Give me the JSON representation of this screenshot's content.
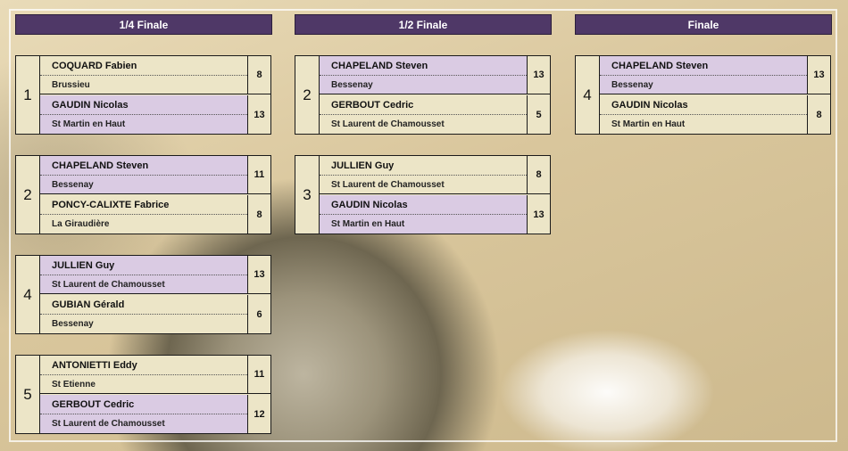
{
  "rounds": [
    {
      "label": "1/4 Finale"
    },
    {
      "label": "1/2 Finale"
    },
    {
      "label": "Finale"
    }
  ],
  "colors": {
    "header_bg": "#4f3867",
    "winner_bg": "#dacbe3",
    "loser_bg": "#ece5c7"
  },
  "matches": [
    {
      "round": "1/4 Finale",
      "num": "1",
      "p1": {
        "name": "COQUARD Fabien",
        "club": "Brussieu",
        "score": "8",
        "winner": false
      },
      "p2": {
        "name": "GAUDIN Nicolas",
        "club": "St Martin en Haut",
        "score": "13",
        "winner": true
      }
    },
    {
      "round": "1/4 Finale",
      "num": "2",
      "p1": {
        "name": "CHAPELAND Steven",
        "club": "Bessenay",
        "score": "11",
        "winner": true
      },
      "p2": {
        "name": "PONCY-CALIXTE Fabrice",
        "club": "La Giraudière",
        "score": "8",
        "winner": false
      }
    },
    {
      "round": "1/4 Finale",
      "num": "4",
      "p1": {
        "name": "JULLIEN Guy",
        "club": "St Laurent de Chamousset",
        "score": "13",
        "winner": true
      },
      "p2": {
        "name": "GUBIAN Gérald",
        "club": "Bessenay",
        "score": "6",
        "winner": false
      }
    },
    {
      "round": "1/4 Finale",
      "num": "5",
      "p1": {
        "name": "ANTONIETTI Eddy",
        "club": "St Etienne",
        "score": "11",
        "winner": false
      },
      "p2": {
        "name": "GERBOUT Cedric",
        "club": "St Laurent de Chamousset",
        "score": "12",
        "winner": true
      }
    },
    {
      "round": "1/2 Finale",
      "num": "2",
      "p1": {
        "name": "CHAPELAND Steven",
        "club": "Bessenay",
        "score": "13",
        "winner": true
      },
      "p2": {
        "name": "GERBOUT Cedric",
        "club": "St Laurent de Chamousset",
        "score": "5",
        "winner": false
      }
    },
    {
      "round": "1/2 Finale",
      "num": "3",
      "p1": {
        "name": "JULLIEN Guy",
        "club": "St Laurent de Chamousset",
        "score": "8",
        "winner": false
      },
      "p2": {
        "name": "GAUDIN Nicolas",
        "club": "St Martin en Haut",
        "score": "13",
        "winner": true
      }
    },
    {
      "round": "Finale",
      "num": "4",
      "p1": {
        "name": "CHAPELAND Steven",
        "club": "Bessenay",
        "score": "13",
        "winner": true
      },
      "p2": {
        "name": "GAUDIN Nicolas",
        "club": "St Martin en Haut",
        "score": "8",
        "winner": false
      }
    }
  ]
}
